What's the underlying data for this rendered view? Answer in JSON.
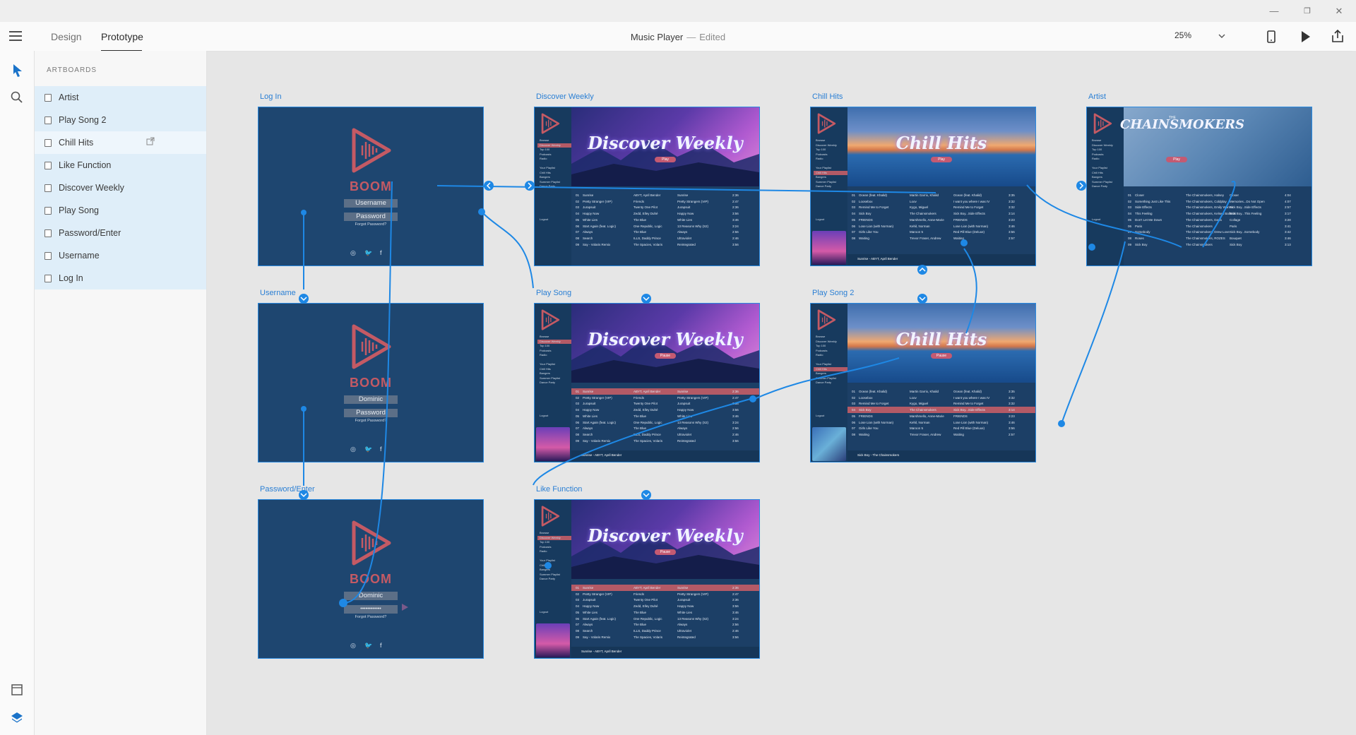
{
  "window": {
    "minimize": "—",
    "restore": "❐",
    "close": "✕"
  },
  "topbar": {
    "tabs": [
      {
        "label": "Design",
        "active": false
      },
      {
        "label": "Prototype",
        "active": true
      }
    ],
    "document_title": "Music Player",
    "separator": "—",
    "status": "Edited",
    "zoom": "25%",
    "icons": [
      "hamburger-menu-icon",
      "chevron-down-icon",
      "phone-preview-icon",
      "play-icon",
      "share-icon"
    ]
  },
  "leftbar": {
    "icons": [
      "select-arrow-icon",
      "search-icon",
      "artboard-icon",
      "layers-icon"
    ]
  },
  "layers": {
    "heading": "ARTBOARDS",
    "items": [
      {
        "label": "Artist"
      },
      {
        "label": "Play Song 2"
      },
      {
        "label": "Chill Hits"
      },
      {
        "label": "Like Function"
      },
      {
        "label": "Discover Weekly"
      },
      {
        "label": "Play Song"
      },
      {
        "label": "Password/Enter"
      },
      {
        "label": "Username"
      },
      {
        "label": "Log In"
      }
    ]
  },
  "artboards": {
    "login": {
      "label": "Log In",
      "brand": "BOOM",
      "user": "Username",
      "pass": "Password",
      "forgot": "Forgot Password?"
    },
    "username": {
      "label": "Username",
      "brand": "BOOM",
      "user": "Dominic",
      "pass": "Password",
      "forgot": "Forgot Password?"
    },
    "password": {
      "label": "Password/Enter",
      "brand": "BOOM",
      "user": "Dominic",
      "pass": "••••••••••••",
      "forgot": "Forgot Password?"
    },
    "discover": {
      "label": "Discover Weekly",
      "title": "Discover Weekly",
      "button": "Play"
    },
    "playsong": {
      "label": "Play Song",
      "title": "Discover Weekly",
      "button": "Pause"
    },
    "like": {
      "label": "Like Function",
      "title": "Discover Weekly",
      "button": "Pause"
    },
    "chill": {
      "label": "Chill Hits",
      "title": "Chill Hits",
      "button": "Play"
    },
    "playsong2": {
      "label": "Play Song 2",
      "title": "Chill Hits",
      "button": "Pause"
    },
    "artist": {
      "label": "Artist",
      "title": "CHAINSMOKERS",
      "kicker": "THE",
      "button": "Play"
    }
  },
  "social": {
    "instagram": "◎",
    "twitter": "🐦",
    "facebook": "f"
  },
  "sidebar_nav": [
    "Browse",
    "Discover Weekly",
    "Top 100",
    "Podcasts",
    "Radio",
    "",
    "Your Playlist",
    "Chill Hits",
    "Bangers",
    "Summer Playlist",
    "Dance Party"
  ],
  "logout": "Logout",
  "tracks_dw": [
    [
      "01",
      "Sunrise",
      "ABYT, April Bender",
      "Sunrise",
      "2:36"
    ],
    [
      "02",
      "Pretty Stranger (VIP)",
      "Friends",
      "Pretty Strangers (VIP)",
      "2:47"
    ],
    [
      "03",
      "Jurapsuit",
      "Twenty One Pilot",
      "Jurapsuit",
      "2:36"
    ],
    [
      "04",
      "Happy Now",
      "Zedd, Elley Duhé",
      "Happy Now",
      "3:56"
    ],
    [
      "05",
      "White Lies",
      "The Blue",
      "White Lies",
      "3:46"
    ],
    [
      "06",
      "Start Again (feat. Logic)",
      "One Republic, Logic",
      "13 Reasons Why (S2)",
      "3:24"
    ],
    [
      "07",
      "Always",
      "The Blue",
      "Always",
      "2:56"
    ],
    [
      "08",
      "Search",
      "ILLS, Daddy Prince",
      "Ultraviolet",
      "2:46"
    ],
    [
      "09",
      "Say - Volaris Remix",
      "The Spacies, Volaris",
      "Reintegrated",
      "3:56"
    ]
  ],
  "tracks_ch": [
    [
      "01",
      "Ocean (feat. Khalid)",
      "Martin Garrix, Khalid",
      "Ocean (feat. Khalid)",
      "3:35"
    ],
    [
      "02",
      "Loosebox",
      "Loov",
      "I want you where I was IV",
      "3:32"
    ],
    [
      "03",
      "Remind Me to Forget",
      "Kygo, Miguel",
      "Remind Me to Forget",
      "3:32"
    ],
    [
      "04",
      "Sick Boy",
      "The Chainsmokers",
      "Sick Boy...Side Effects",
      "3:14"
    ],
    [
      "05",
      "FRIENDS",
      "Marshmello, Anne-Marie",
      "FRIENDS",
      "3:23"
    ],
    [
      "06",
      "Lose Lion (with Norman)",
      "Kehil, Norman",
      "Lose Lion (with Norman)",
      "3:46"
    ],
    [
      "07",
      "Girls Like You",
      "Maroon 5",
      "Red Pill Blue (Deluxe)",
      "3:56"
    ],
    [
      "08",
      "Waiting",
      "Trevor Fraser, Andrew",
      "Waiting",
      "2:57"
    ]
  ],
  "tracks_ar": [
    [
      "01",
      "Closer",
      "The Chainsmokers, Halsey",
      "Closer",
      "4:04"
    ],
    [
      "02",
      "Something Just Like This",
      "The Chainsmokers, Coldplay",
      "Memories...Do Not Open",
      "4:07"
    ],
    [
      "03",
      "Side Effects",
      "The Chainsmokers, Emily Warren",
      "Sick Boy...Side Effects",
      "2:57"
    ],
    [
      "04",
      "This Feeling",
      "The Chainsmokers, Kelsea Ballerini",
      "Sick Boy...This Feeling",
      "3:17"
    ],
    [
      "05",
      "Don't Let Me Down",
      "The Chainsmokers, Daya",
      "Collage",
      "3:28"
    ],
    [
      "06",
      "Paris",
      "The Chainsmokers",
      "Paris",
      "3:41"
    ],
    [
      "07",
      "Somebody",
      "The Chainsmokers, Drew Love",
      "Sick Boy...Somebody",
      "3:42"
    ],
    [
      "08",
      "Roses",
      "The Chainsmokers, ROZES",
      "Bouquet",
      "3:46"
    ],
    [
      "09",
      "Sick Boy",
      "The Chainsmokers",
      "Sick Boy",
      "3:13"
    ]
  ],
  "now_playing": {
    "playsong": "Sunrise - ABYT, April Bender",
    "like": "Sunrise - ABYT, April Bender",
    "chill": "Sunrise - ABYT, April Bender",
    "playsong2": "Sick Boy - The Chainsmokers"
  },
  "colors": {
    "accent": "#2a8ae0",
    "artboard_bg": "#1e4670",
    "brand": "#c45a64",
    "canvas": "#e6e6e6"
  }
}
